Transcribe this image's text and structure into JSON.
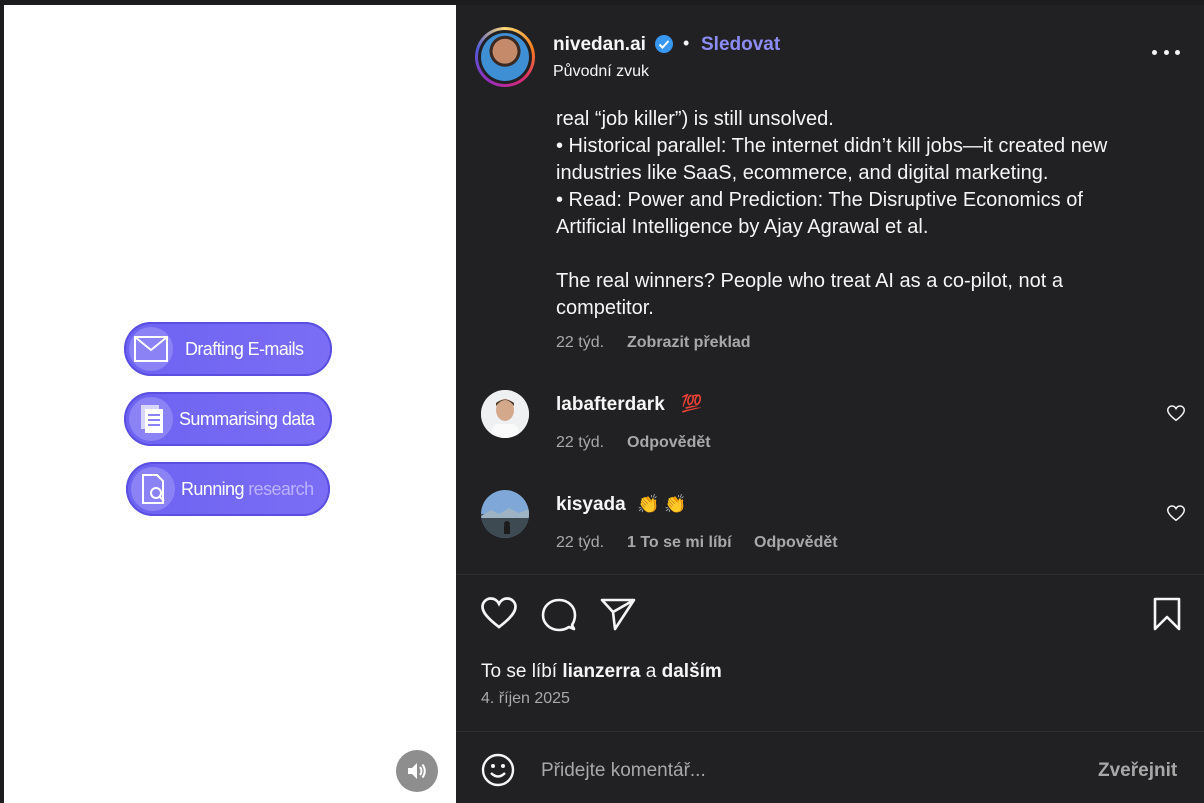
{
  "media": {
    "pills": [
      {
        "label": "Drafting E-mails",
        "icon": "envelope-icon"
      },
      {
        "label": "Summarising data",
        "icon": "documents-icon"
      },
      {
        "label_main": "Running",
        "label_dim": "research",
        "icon": "search-document-icon"
      }
    ],
    "sound_icon": "speaker-icon"
  },
  "post": {
    "username": "nivedan.ai",
    "verified_icon": "verified-badge-icon",
    "separator": "•",
    "follow_label": "Sledovat",
    "audio": "Původní zvuk",
    "more_icon": "more-options-icon",
    "caption": [
      "real “job killer”) is still unsolved.",
      "• Historical parallel: The internet didn’t kill jobs—it created new industries like SaaS, ecommerce, and digital marketing.",
      "• Read: Power and Prediction: The Disruptive Economics of Artificial Intelligence by Ajay Agrawal et al.",
      "",
      "The real winners? People who treat AI as a co-pilot, not a competitor."
    ],
    "caption_time": "22 týd.",
    "translate_label": "Zobrazit překlad"
  },
  "comments": [
    {
      "user": "labafterdark",
      "text": "💯",
      "time": "22 týd.",
      "likes": "",
      "reply": "Odpovědět"
    },
    {
      "user": "kisyada",
      "text": "👏 👏",
      "time": "22 týd.",
      "likes": "1 To se mi líbí",
      "reply": "Odpovědět"
    }
  ],
  "actions": {
    "like_icon": "heart-icon",
    "comment_icon": "comment-bubble-icon",
    "share_icon": "paper-plane-icon",
    "save_icon": "bookmark-icon"
  },
  "likes": {
    "prefix": "To se líbí",
    "user": "lianzerra",
    "connector": "a",
    "others": "dalším"
  },
  "date": "4. říjen 2025",
  "composer": {
    "emoji_icon": "emoji-icon",
    "placeholder": "Přidejte komentář...",
    "publish_label": "Zveřejnit"
  },
  "colors": {
    "panel_bg": "#212124",
    "follow": "#8c8cf5",
    "pill": "#6d63f2",
    "muted": "#a8a8a8"
  }
}
